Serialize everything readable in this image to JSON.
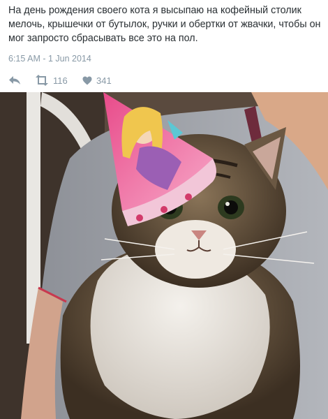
{
  "tweet": {
    "text": "На день рождения своего кота я высыпаю на кофейный столик мелочь, крышечки от бутылок, ручки и обертки от жвачки, чтобы он мог запросто сбрасывать все это на пол.",
    "timestamp": "6:15 AM - 1 Jun 2014"
  },
  "actions": {
    "reply_icon": "reply-icon",
    "retweet_icon": "retweet-icon",
    "retweet_count": "116",
    "favorite_icon": "heart-icon",
    "favorite_count": "341"
  },
  "colors": {
    "text": "#292f33",
    "muted": "#8899a6"
  }
}
